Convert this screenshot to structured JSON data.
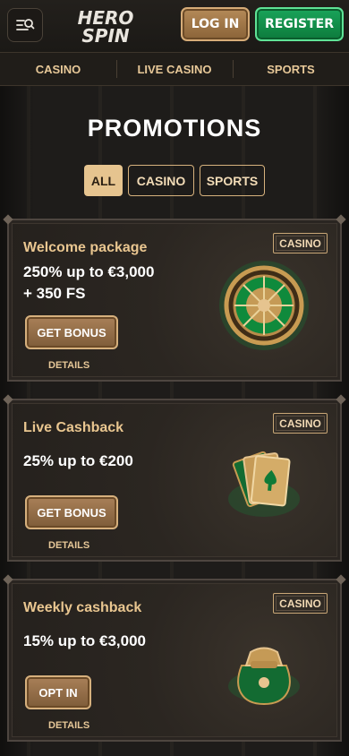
{
  "header": {
    "logo_line1": "HERO",
    "logo_line2": "SPIN",
    "login_label": "LOG IN",
    "register_label": "REGISTER"
  },
  "nav": {
    "items": [
      {
        "label": "CASINO"
      },
      {
        "label": "LIVE CASINO"
      },
      {
        "label": "SPORTS"
      }
    ]
  },
  "page": {
    "title": "PROMOTIONS",
    "filters": [
      {
        "label": "ALL",
        "active": true
      },
      {
        "label": "CASINO",
        "active": false
      },
      {
        "label": "SPORTS",
        "active": false
      }
    ]
  },
  "promotions": [
    {
      "badge": "CASINO",
      "title": "Welcome package",
      "offer_line1": "250% up to €3,000",
      "offer_line2": "+ 350 FS",
      "button_label": "GET BONUS",
      "details_label": "DETAILS",
      "art_icon": "roulette-wheel-icon"
    },
    {
      "badge": "CASINO",
      "title": "Live Cashback",
      "offer_line1": "25% up to €200",
      "offer_line2": "",
      "button_label": "GET BONUS",
      "details_label": "DETAILS",
      "art_icon": "playing-cards-icon"
    },
    {
      "badge": "CASINO",
      "title": "Weekly cashback",
      "offer_line1": "15% up to €3,000",
      "offer_line2": "",
      "button_label": "OPT IN",
      "details_label": "DETAILS",
      "art_icon": "money-bag-icon"
    }
  ],
  "colors": {
    "accent_gold": "#e6c48f",
    "brand_green": "#19a45a",
    "background": "#1f1d1a"
  }
}
